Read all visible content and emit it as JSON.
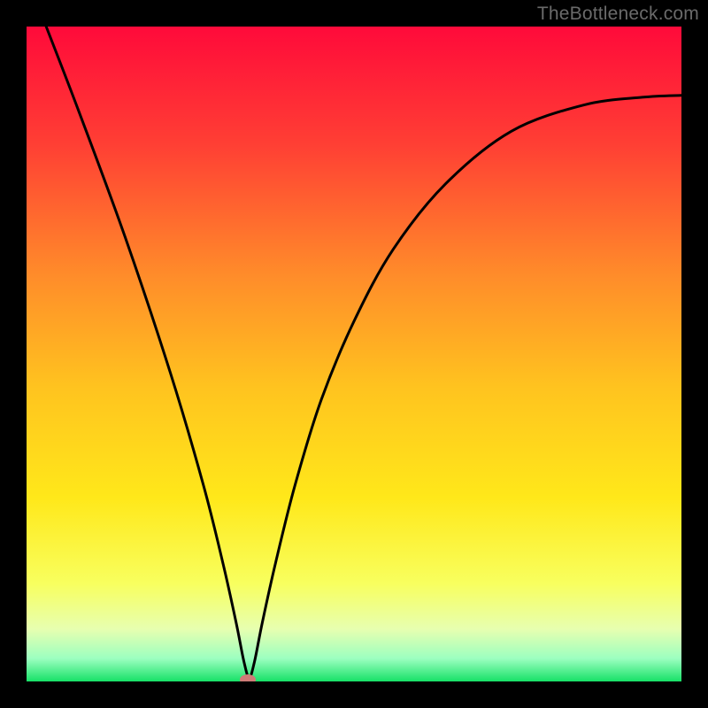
{
  "watermark": "TheBottleneck.com",
  "chart_data": {
    "type": "line",
    "title": "",
    "xlabel": "",
    "ylabel": "",
    "xlim": [
      0,
      1
    ],
    "ylim": [
      0,
      1
    ],
    "gradient_stops": [
      {
        "t": 0.0,
        "color": "#ff0a3a"
      },
      {
        "t": 0.18,
        "color": "#ff3f34"
      },
      {
        "t": 0.38,
        "color": "#ff8c2a"
      },
      {
        "t": 0.55,
        "color": "#ffc31f"
      },
      {
        "t": 0.72,
        "color": "#ffe81a"
      },
      {
        "t": 0.85,
        "color": "#f8ff5e"
      },
      {
        "t": 0.92,
        "color": "#e7ffb0"
      },
      {
        "t": 0.965,
        "color": "#9cffc0"
      },
      {
        "t": 1.0,
        "color": "#17e167"
      }
    ],
    "series": [
      {
        "name": "bottleneck-curve",
        "x": [
          0.03,
          0.08,
          0.15,
          0.22,
          0.27,
          0.3,
          0.32,
          0.332,
          0.34,
          0.348,
          0.36,
          0.38,
          0.41,
          0.45,
          0.5,
          0.56,
          0.64,
          0.74,
          0.85,
          0.94,
          1.0
        ],
        "y": [
          1.0,
          0.87,
          0.68,
          0.47,
          0.3,
          0.18,
          0.09,
          0.03,
          0.006,
          0.03,
          0.09,
          0.18,
          0.3,
          0.43,
          0.55,
          0.66,
          0.76,
          0.84,
          0.88,
          0.892,
          0.895
        ]
      }
    ],
    "marker": {
      "name": "optimal-point",
      "x": 0.338,
      "y": 0.003,
      "color": "#cf7b77"
    }
  }
}
